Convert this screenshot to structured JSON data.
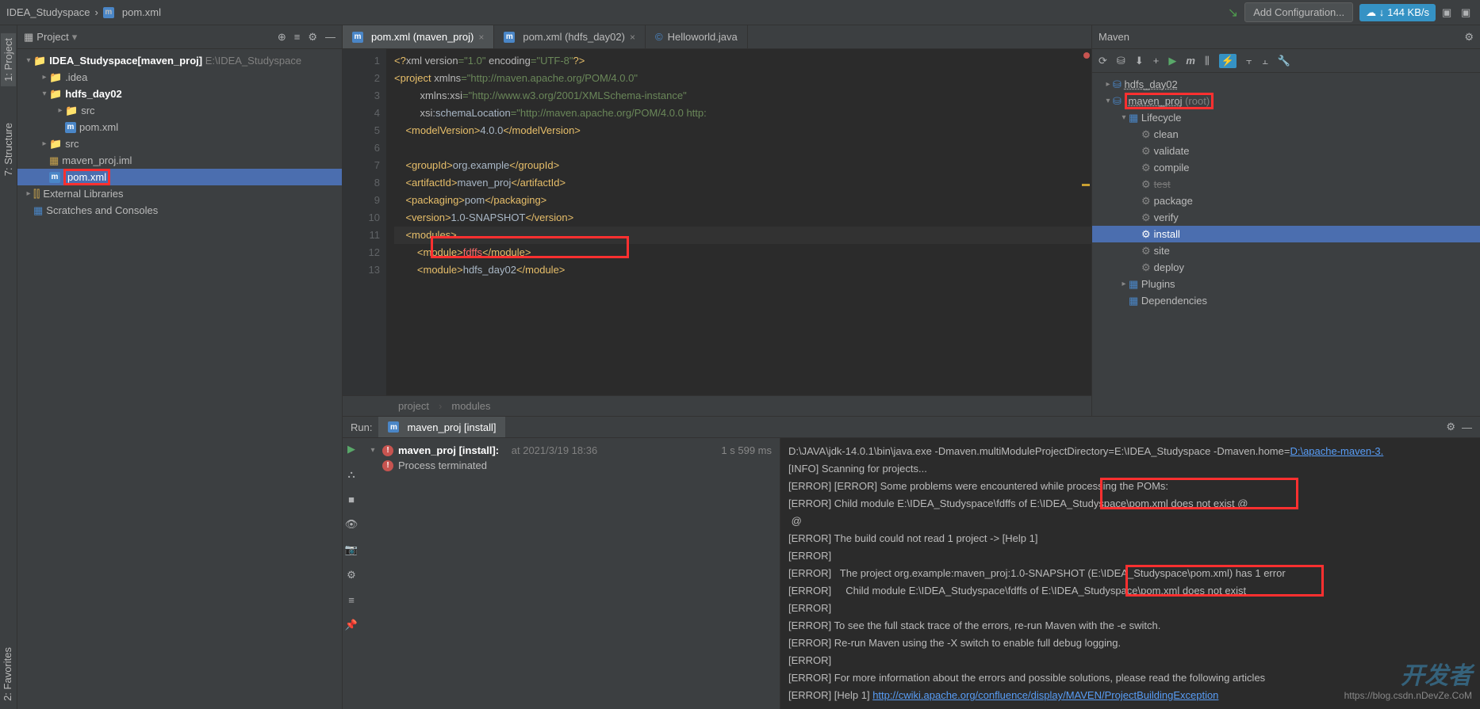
{
  "breadcrumb": {
    "root": "IDEA_Studyspace",
    "file": "pom.xml"
  },
  "topbar": {
    "config": "Add Configuration...",
    "net_speed": "144 KB/s"
  },
  "project_panel": {
    "title": "Project"
  },
  "tree": {
    "root": {
      "name": "IDEA_Studyspace",
      "module": "[maven_proj]",
      "path": "E:\\IDEA_Studyspace"
    },
    "idea": ".idea",
    "hdfs": "hdfs_day02",
    "src1": "src",
    "pom1": "pom.xml",
    "src2": "src",
    "iml": "maven_proj.iml",
    "pom2": "pom.xml",
    "ext": "External Libraries",
    "scratch": "Scratches and Consoles"
  },
  "tabs": [
    {
      "label": "pom.xml (maven_proj)",
      "active": true
    },
    {
      "label": "pom.xml (hdfs_day02)",
      "active": false
    },
    {
      "label": "Helloworld.java",
      "active": false
    }
  ],
  "code": {
    "l1": {
      "p1": "<?",
      "p2": "xml version",
      "p3": "=\"1.0\" ",
      "p4": "encoding",
      "p5": "=\"UTF-8\"",
      "p6": "?>"
    },
    "l2": {
      "p1": "<project ",
      "p2": "xmlns",
      "p3": "=\"http://maven.apache.org/POM/4.0.0\""
    },
    "l3": {
      "p1": "         ",
      "p2": "xmlns:xsi",
      "p3": "=\"http://www.w3.org/2001/XMLSchema-instance\""
    },
    "l4": {
      "p1": "         ",
      "p2": "xsi",
      "p3": ":schemaLocation",
      "p4": "=\"http://maven.apache.org/POM/4.0.0 http:"
    },
    "l5": {
      "o": "    <modelVersion>",
      "t": "4.0.0",
      "c": "</modelVersion>"
    },
    "l7": {
      "o": "    <groupId>",
      "t": "org.example",
      "c": "</groupId>"
    },
    "l8": {
      "o": "    <artifactId>",
      "t": "maven_proj",
      "c": "</artifactId>"
    },
    "l9": {
      "o": "    <packaging>",
      "t": "pom",
      "c": "</packaging>"
    },
    "l10": {
      "o": "    <version>",
      "t": "1.0-SNAPSHOT",
      "c": "</version>"
    },
    "l11": {
      "o": "    <modules>"
    },
    "l12": {
      "o": "        <module>",
      "t": "fdffs",
      "c": "</module>"
    },
    "l13": {
      "o": "        <module>",
      "t": "hdfs_day02",
      "c": "</module>"
    }
  },
  "editor_crumb": {
    "a": "project",
    "b": "modules"
  },
  "maven": {
    "title": "Maven",
    "hdfs": "hdfs_day02",
    "proj": "maven_proj",
    "proj_suffix": "(root)",
    "lifecycle": "Lifecycle",
    "goals": [
      "clean",
      "validate",
      "compile",
      "test",
      "package",
      "verify",
      "install",
      "site",
      "deploy"
    ],
    "plugins": "Plugins",
    "deps": "Dependencies"
  },
  "run": {
    "title": "Run:",
    "tab": "maven_proj [install]",
    "node": "maven_proj [install]:",
    "node_time": "at 2021/3/19 18:36",
    "node_dur": "1 s 599 ms",
    "terminated": "Process terminated"
  },
  "console": [
    {
      "t": "D:\\JAVA\\jdk-14.0.1\\bin\\java.exe -Dmaven.multiModuleProjectDirectory=E:\\IDEA_Studyspace -Dmaven.home=",
      "link": "D:\\apache-maven-3."
    },
    {
      "t": "[INFO] Scanning for projects..."
    },
    {
      "t": "[ERROR] [ERROR] Some problems were encountered while processing the POMs:"
    },
    {
      "t": "[ERROR] Child module E:\\IDEA_Studyspace\\fdffs of E:\\IDEA_Studyspace\\pom.xml does not exist @"
    },
    {
      "t": " @"
    },
    {
      "t": "[ERROR] The build could not read 1 project -> [Help 1]"
    },
    {
      "t": "[ERROR] "
    },
    {
      "t": "[ERROR]   The project org.example:maven_proj:1.0-SNAPSHOT (E:\\IDEA_Studyspace\\pom.xml) has 1 error"
    },
    {
      "t": "[ERROR]     Child module E:\\IDEA_Studyspace\\fdffs of E:\\IDEA_Studyspace\\pom.xml does not exist"
    },
    {
      "t": "[ERROR] "
    },
    {
      "t": "[ERROR] To see the full stack trace of the errors, re-run Maven with the -e switch."
    },
    {
      "t": "[ERROR] Re-run Maven using the -X switch to enable full debug logging."
    },
    {
      "t": "[ERROR] "
    },
    {
      "t": "[ERROR] For more information about the errors and possible solutions, please read the following articles"
    },
    {
      "t": "[ERROR] [Help 1] ",
      "link": "http://cwiki.apache.org/confluence/display/MAVEN/ProjectBuildingException"
    }
  ],
  "watermark": "开发者",
  "footer_url": "https://blog.csdn.nDevZe.CoM",
  "left_rail": {
    "project": "1: Project",
    "structure": "7: Structure",
    "fav": "2: Favorites"
  }
}
